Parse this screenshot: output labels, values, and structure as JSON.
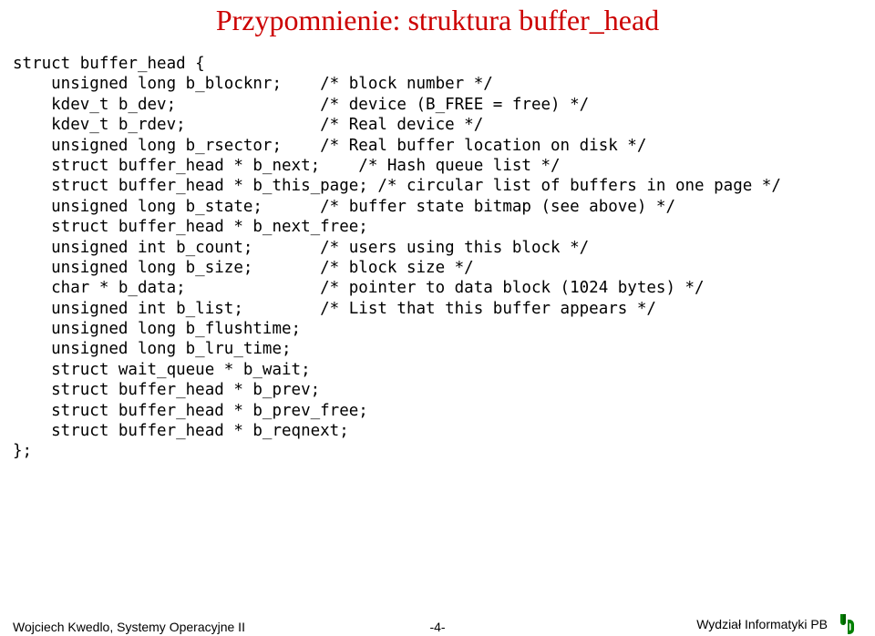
{
  "title": "Przypomnienie: struktura buffer_head",
  "code": "struct buffer_head {\n    unsigned long b_blocknr;    /* block number */\n    kdev_t b_dev;               /* device (B_FREE = free) */\n    kdev_t b_rdev;              /* Real device */\n    unsigned long b_rsector;    /* Real buffer location on disk */\n    struct buffer_head * b_next;    /* Hash queue list */\n    struct buffer_head * b_this_page; /* circular list of buffers in one page */\n    unsigned long b_state;      /* buffer state bitmap (see above) */\n    struct buffer_head * b_next_free;\n    unsigned int b_count;       /* users using this block */\n    unsigned long b_size;       /* block size */\n    char * b_data;              /* pointer to data block (1024 bytes) */\n    unsigned int b_list;        /* List that this buffer appears */\n    unsigned long b_flushtime;\n    unsigned long b_lru_time;\n    struct wait_queue * b_wait;\n    struct buffer_head * b_prev;\n    struct buffer_head * b_prev_free;\n    struct buffer_head * b_reqnext;\n};",
  "footer": {
    "left": "Wojciech Kwedlo, Systemy Operacyjne II",
    "center": "-4-",
    "right": "Wydział Informatyki    PB"
  }
}
